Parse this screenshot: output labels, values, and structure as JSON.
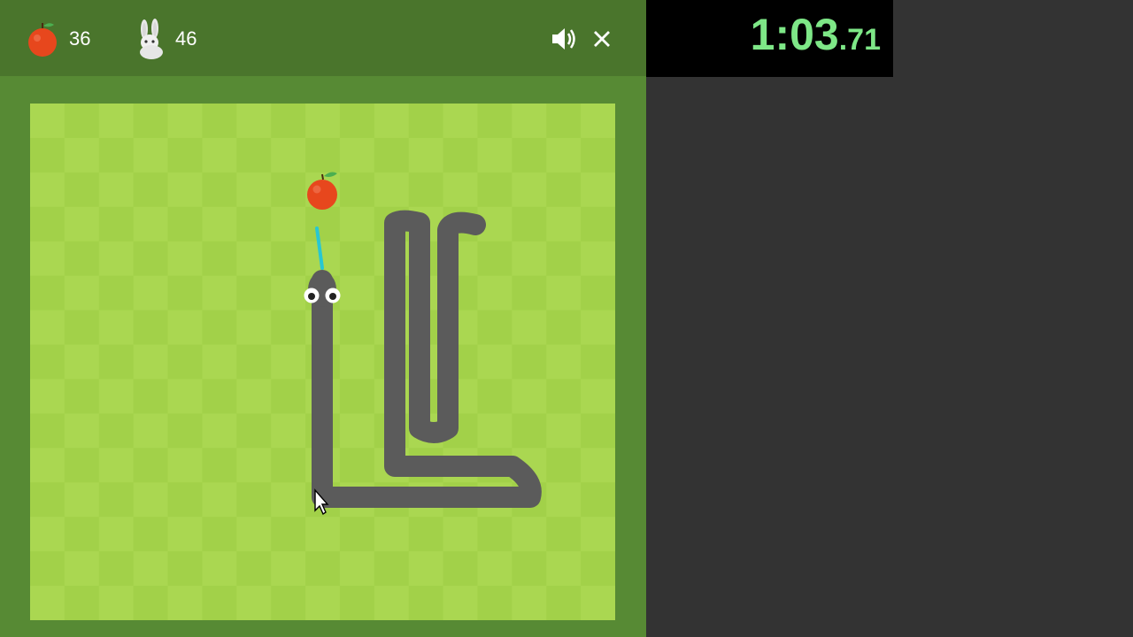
{
  "header": {
    "apple_score": "36",
    "best_score": "46",
    "apple_icon": "apple-icon",
    "best_icon": "rabbit-trophy-icon",
    "sound_icon": "speaker-icon",
    "close_icon": "close-icon"
  },
  "timer": {
    "main": "1:03",
    "fraction": ".71"
  },
  "board": {
    "columns": 17,
    "rows": 15,
    "light_color": "#aad751",
    "dark_color": "#a2d149",
    "snake_color": "#5b5b5b",
    "apple_color": "#e7471d"
  },
  "colors": {
    "header": "#4a752c",
    "frame": "#578a34",
    "timer_text": "#7ee787",
    "background": "#333333"
  }
}
